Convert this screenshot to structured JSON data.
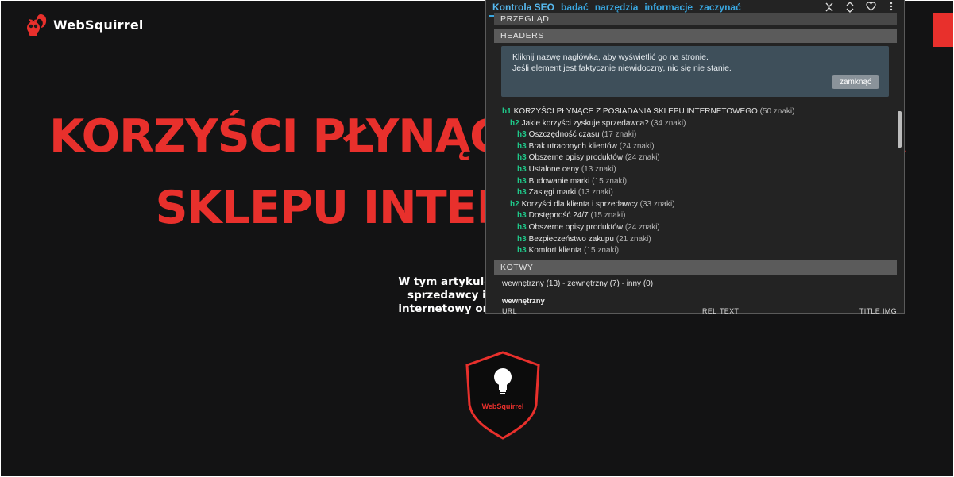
{
  "site": {
    "brand": "WebSquirrel",
    "hero_line_1": "KORZYŚCI PŁYNĄCE Z POSIADANIA",
    "hero_line_2": "SKLEPU INTERNETOWEGO",
    "intro_lines": [
      "W tym artykule dowiesz się",
      "sprzedawcy i kupującym",
      "internetowy oraz jaką pełni"
    ],
    "badge_label": "WebSquirrel",
    "accent": "#e8302c",
    "background": "#131314"
  },
  "seo": {
    "tabs": [
      "Kontrola SEO",
      "badać",
      "narzędzia",
      "informacje",
      "zaczynać"
    ],
    "icons": [
      "collapse-icon",
      "expand-icon",
      "heart-icon",
      "more-vertical-icon"
    ],
    "section_overview": "PRZEGLĄD",
    "section_headers": "HEADERS",
    "notice_line_1": "Kliknij nazwę nagłówka, aby wyświetlić go na stronie.",
    "notice_line_2": "Jeśli element jest faktycznie niewidoczny, nic się nie stanie.",
    "notice_close": "zamknąć",
    "headings": [
      {
        "tag": "h1",
        "text": "KORZYŚCI PŁYNĄCE Z POSIADANIA SKLEPU INTERNETOWEGO",
        "count": "(50 znaki)"
      },
      {
        "tag": "h2",
        "text": "Jakie korzyści zyskuje sprzedawca?",
        "count": "(34 znaki)"
      },
      {
        "tag": "h3",
        "text": "Oszczędność czasu",
        "count": "(17 znaki)"
      },
      {
        "tag": "h3",
        "text": "Brak utraconych klientów",
        "count": "(24 znaki)"
      },
      {
        "tag": "h3",
        "text": "Obszerne opisy produktów",
        "count": "(24 znaki)"
      },
      {
        "tag": "h3",
        "text": "Ustalone ceny",
        "count": "(13 znaki)"
      },
      {
        "tag": "h3",
        "text": "Budowanie marki",
        "count": "(15 znaki)"
      },
      {
        "tag": "h3",
        "text": "Zasięgi marki",
        "count": "(13 znaki)"
      },
      {
        "tag": "h2",
        "text": "Korzyści dla klienta i sprzedawcy",
        "count": "(33 znaki)"
      },
      {
        "tag": "h3",
        "text": "Dostępność 24/7",
        "count": "(15 znaki)"
      },
      {
        "tag": "h3",
        "text": "Obszerne opisy produktów",
        "count": "(24 znaki)"
      },
      {
        "tag": "h3",
        "text": "Bezpieczeństwo zakupu",
        "count": "(21 znaki)"
      },
      {
        "tag": "h3",
        "text": "Komfort klienta",
        "count": "(15 znaki)"
      }
    ],
    "section_anchors": "KOTWY",
    "anchors_summary": "wewnętrzny (13) - zewnętrzny (7) - inny (0)",
    "anchors_subheading": "wewnętrzny",
    "anchors_columns": [
      "URL",
      "REL",
      "TEXT",
      "TITLE",
      "IMG"
    ]
  }
}
